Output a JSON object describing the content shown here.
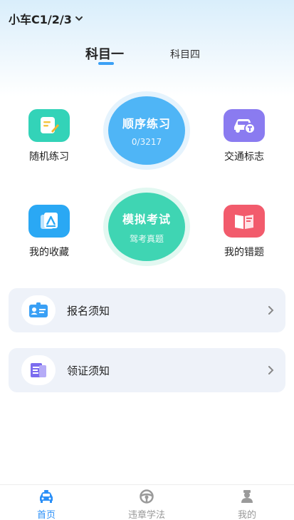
{
  "header": {
    "license_type": "小车C1/2/3"
  },
  "tabs": [
    {
      "label": "科目一",
      "active": true
    },
    {
      "label": "科目四",
      "active": false
    }
  ],
  "features": {
    "random": "随机练习",
    "traffic_signs": "交通标志",
    "favorites": "我的收藏",
    "mistakes": "我的错题"
  },
  "sequential": {
    "title": "顺序练习",
    "progress": "0/3217"
  },
  "mock_exam": {
    "title": "模拟考试",
    "subtitle": "驾考真题"
  },
  "cards": [
    {
      "label": "报名须知",
      "icon": "id-card-icon"
    },
    {
      "label": "领证须知",
      "icon": "document-icon"
    }
  ],
  "bottom_nav": [
    {
      "label": "首页",
      "icon": "car-icon",
      "active": true
    },
    {
      "label": "违章学法",
      "icon": "steering-wheel-icon",
      "active": false
    },
    {
      "label": "我的",
      "icon": "user-icon",
      "active": false
    }
  ],
  "colors": {
    "accent": "#2a8ff7",
    "sequential": "#4fb5f6",
    "mock_exam": "#3fd5b3",
    "random_tile": "#33d3b8",
    "signs_tile": "#8a7bf0",
    "favorites_tile": "#2aa8f4",
    "mistakes_tile": "#f25b6c"
  }
}
